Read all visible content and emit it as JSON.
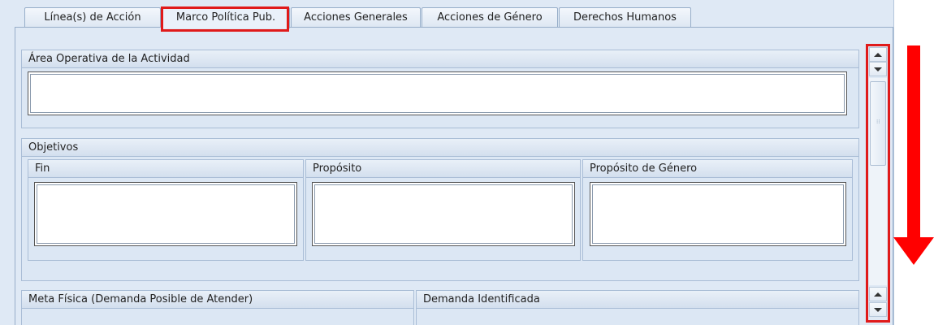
{
  "tabs": [
    {
      "label": "Línea(s) de Acción",
      "active": false
    },
    {
      "label": "Marco Política Pub.",
      "active": true
    },
    {
      "label": "Acciones Generales",
      "active": false
    },
    {
      "label": "Acciones de Género",
      "active": false
    },
    {
      "label": "Derechos Humanos",
      "active": false
    }
  ],
  "area_operativa": {
    "title": "Área Operativa de la Actividad",
    "value": ""
  },
  "objetivos": {
    "title": "Objetivos",
    "fin": {
      "title": "Fin",
      "value": ""
    },
    "proposito": {
      "title": "Propósito",
      "value": ""
    },
    "proposito_genero": {
      "title": "Propósito de Género",
      "value": ""
    }
  },
  "meta_fisica": {
    "title": "Meta Física (Demanda Posible de Atender)"
  },
  "demanda_identificada": {
    "title": "Demanda Identificada"
  },
  "colors": {
    "highlight": "#e01a1a",
    "panel_bg": "#dfe9f5",
    "border": "#97aec9"
  },
  "icons": {
    "scroll_up": "triangle-up-icon",
    "scroll_down": "triangle-down-icon",
    "annotation": "red-down-arrow-icon"
  }
}
